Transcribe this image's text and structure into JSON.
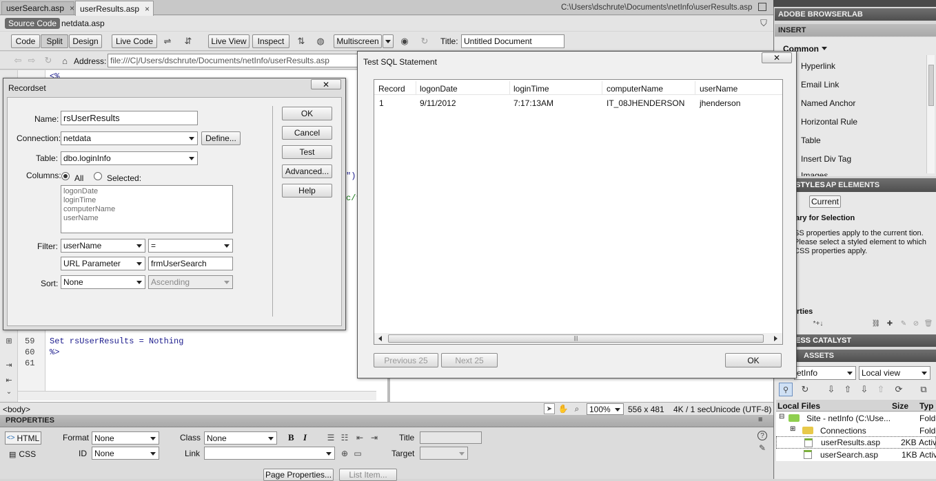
{
  "tabs": [
    {
      "label": "userSearch.asp",
      "close": "×"
    },
    {
      "label": "userResults.asp",
      "close": "×"
    }
  ],
  "doc_path": "C:\\Users\\dschrute\\Documents\\netInfo\\userResults.asp",
  "related_files": {
    "source_code": "Source Code",
    "netdata": "netdata.asp"
  },
  "doc_toolbar": {
    "code": "Code",
    "split": "Split",
    "design": "Design",
    "live_code": "Live Code",
    "live_view": "Live View",
    "inspect": "Inspect",
    "multiscreen": "Multiscreen",
    "title_label": "Title:",
    "title_value": "Untitled Document"
  },
  "browser_nav": {
    "address_label": "Address:",
    "address_value": "file:///C|/Users/dschrute/Documents/netInfo/userResults.asp"
  },
  "code_view": {
    "lines": [
      {
        "num": "59",
        "text": "Set rsUserResults = Nothing"
      },
      {
        "num": "60",
        "text": "%>"
      },
      {
        "num": "61",
        "text": ""
      }
    ],
    "fragments": [
      "\"))",
      "c/t",
      "<%"
    ]
  },
  "recordset": {
    "title": "Recordset",
    "name_label": "Name:",
    "name_value": "rsUserResults",
    "connection_label": "Connection:",
    "connection_value": "netdata",
    "define": "Define...",
    "table_label": "Table:",
    "table_value": "dbo.loginInfo",
    "columns_label": "Columns:",
    "all": "All",
    "selected": "Selected:",
    "columns": [
      "logonDate",
      "loginTime",
      "computerName",
      "userName"
    ],
    "filter_label": "Filter:",
    "filter_col": "userName",
    "filter_op": "=",
    "filter_source": "URL Parameter",
    "filter_value": "frmUserSearch",
    "sort_label": "Sort:",
    "sort_value": "None",
    "sort_order": "Ascending",
    "buttons": {
      "ok": "OK",
      "cancel": "Cancel",
      "test": "Test",
      "advanced": "Advanced...",
      "help": "Help"
    }
  },
  "sql_test": {
    "title": "Test SQL Statement",
    "headers": [
      "Record",
      "logonDate",
      "loginTime",
      "computerName",
      "userName"
    ],
    "rows": [
      [
        "1",
        "9/11/2012",
        "7:17:13AM",
        "IT_08JHENDERSON",
        "jhenderson"
      ]
    ],
    "prev": "Previous 25",
    "next": "Next 25",
    "ok": "OK"
  },
  "status": {
    "tag": "<body>",
    "zoom": "100%",
    "size": "556 x 481",
    "download": "4K / 1 sec",
    "encoding": "Unicode (UTF-8)"
  },
  "properties": {
    "title": "PROPERTIES",
    "html": "HTML",
    "css": "CSS",
    "format_label": "Format",
    "format_value": "None",
    "id_label": "ID",
    "id_value": "None",
    "class_label": "Class",
    "class_value": "None",
    "link_label": "Link",
    "title_label": "Title",
    "target_label": "Target",
    "bold": "B",
    "italic": "I",
    "page_properties": "Page Properties...",
    "list_item": "List Item..."
  },
  "right_panel": {
    "browserlab": "ADOBE BROWSERLAB",
    "insert": "INSERT",
    "category": "Common",
    "insert_items": [
      "Hyperlink",
      "Email Link",
      "Named Anchor",
      "Horizontal Rule",
      "Table",
      "Insert Div Tag",
      "Images"
    ],
    "css_tabs": [
      "STYLES",
      "AP ELEMENTS"
    ],
    "current": "Current",
    "summary_title": "ary for Selection",
    "summary_text": "SS properties apply to the current tion.  Please select a styled element to which CSS properties apply.",
    "properties_label": "rties",
    "business_catalyst": "ESS CATALYST",
    "files_tab": "ASSETS",
    "site_select": "etInfo",
    "view_select": "Local view",
    "files_header": [
      "Local Files",
      "Size",
      "Typ"
    ],
    "files": [
      {
        "name": "Site - netInfo (C:\\Use...",
        "size": "",
        "type": "Folde"
      },
      {
        "name": "Connections",
        "size": "",
        "type": "Folde"
      },
      {
        "name": "userResults.asp",
        "size": "2KB",
        "type": "Activ"
      },
      {
        "name": "userSearch.asp",
        "size": "1KB",
        "type": "Activ"
      }
    ]
  }
}
